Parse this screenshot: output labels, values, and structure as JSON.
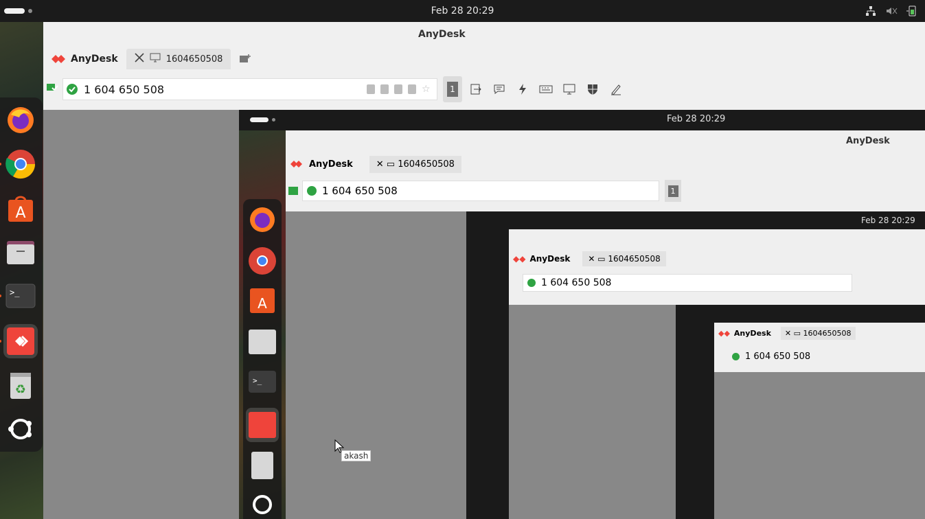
{
  "topbar": {
    "clock": "Feb 28  20:29"
  },
  "dock": {
    "items": [
      "firefox-icon",
      "chrome-icon",
      "app-center-icon",
      "files-icon",
      "terminal-icon",
      "anydesk-icon",
      "trash-icon",
      "ubuntu-icon"
    ]
  },
  "window": {
    "title": "AnyDesk",
    "brand": "AnyDesk",
    "tab_label": "1604650508",
    "address": "1 604 650 508",
    "monitor_number": "1"
  },
  "nested": {
    "clock": "Feb 28  20:29",
    "title": "AnyDesk",
    "brand": "AnyDesk",
    "tab_label": "1604650508",
    "address": "1 604 650 508",
    "monitor_number": "1"
  },
  "cursor_tooltip": "akash",
  "colors": {
    "accent_red": "#ef443b",
    "success_green": "#2fa343"
  }
}
